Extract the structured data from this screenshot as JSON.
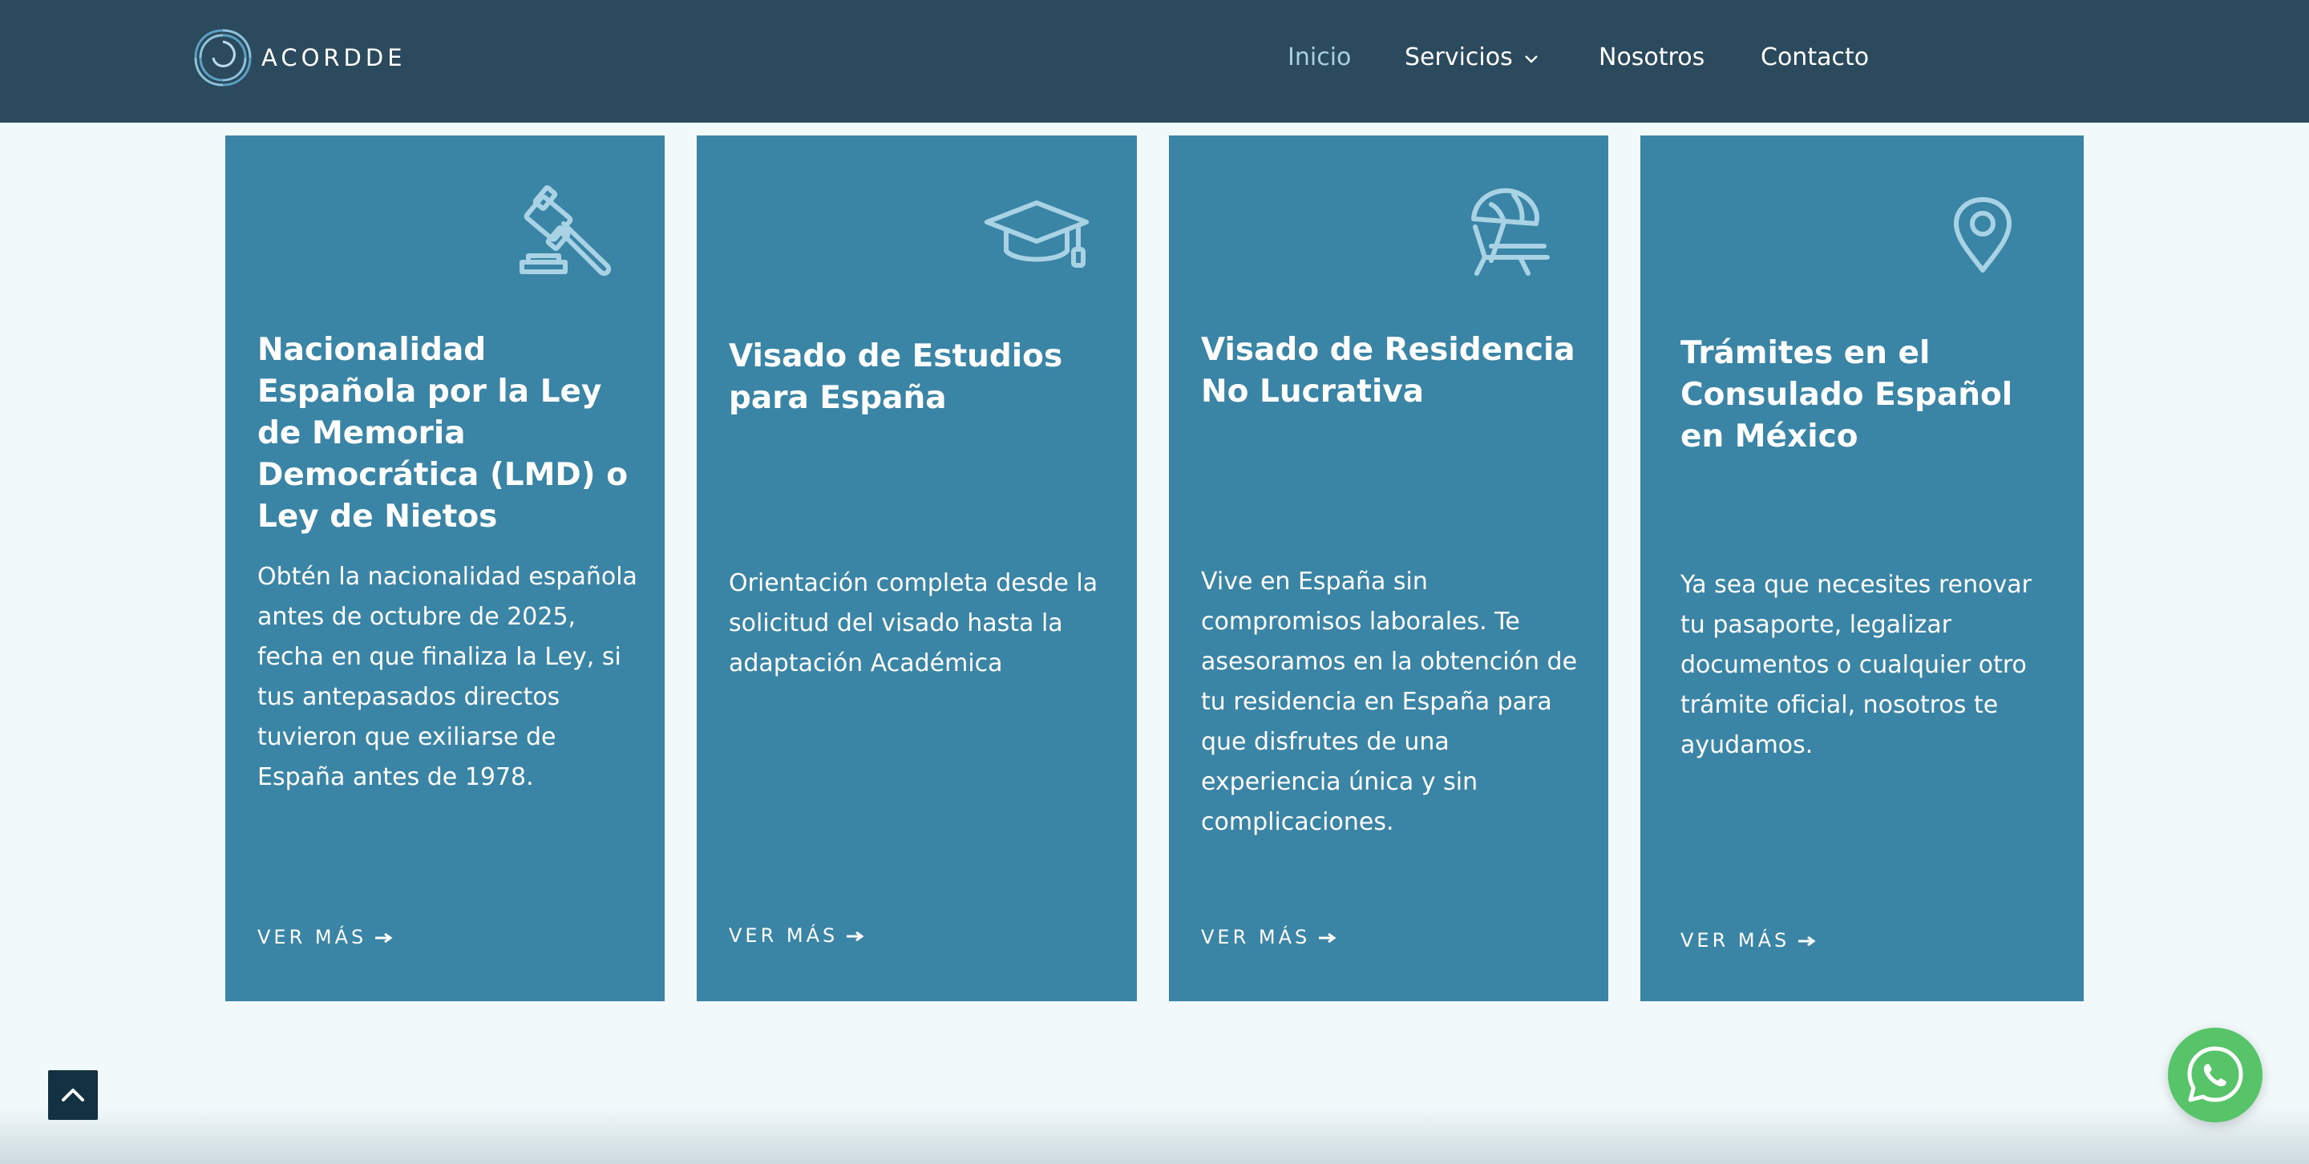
{
  "brand": {
    "name": "ACORDDE",
    "logo_icon": "swirl-logo-icon"
  },
  "nav": {
    "items": [
      {
        "label": "Inicio",
        "active": true
      },
      {
        "label": "Servicios",
        "has_dropdown": true
      },
      {
        "label": "Nosotros"
      },
      {
        "label": "Contacto"
      }
    ]
  },
  "cards": [
    {
      "icon": "gavel-icon",
      "title": "Nacionalidad Española por la Ley de Memoria Democrática (LMD) o Ley de Nietos",
      "description": "Obtén la nacionalidad española antes de octubre de 2025, fecha en que finaliza la Ley, si tus antepasados directos tuvieron que exiliarse de España antes de 1978.",
      "link": "VER MÁS"
    },
    {
      "icon": "graduation-cap-icon",
      "title": "Visado de Estudios para España",
      "description": "Orientación completa desde la solicitud del visado hasta la adaptación Académica",
      "link": "VER MÁS"
    },
    {
      "icon": "beach-umbrella-chair-icon",
      "title": "Visado de Residencia No Lucrativa",
      "description": "Vive en España sin compromisos laborales. Te asesoramos en la obtención de tu residencia en España para que disfrutes de una experiencia única y sin complicaciones.",
      "link": "VER MÁS"
    },
    {
      "icon": "map-pin-icon",
      "title": "Trámites en el Consulado Español en México",
      "description": "Ya sea que necesites renovar tu pasaporte, legalizar documentos o cualquier otro trámite oficial, nosotros te ayudamos.",
      "link": "VER MÁS"
    }
  ],
  "floating": {
    "scroll_top_icon": "chevron-up-icon",
    "whatsapp_icon": "whatsapp-icon"
  },
  "colors": {
    "header": "#2b4a5d",
    "card": "#3a85a5",
    "background": "#f1f9fb",
    "nav_active": "#a8d0e0",
    "whatsapp": "#57c46a",
    "icon": "#a9d3e4"
  }
}
